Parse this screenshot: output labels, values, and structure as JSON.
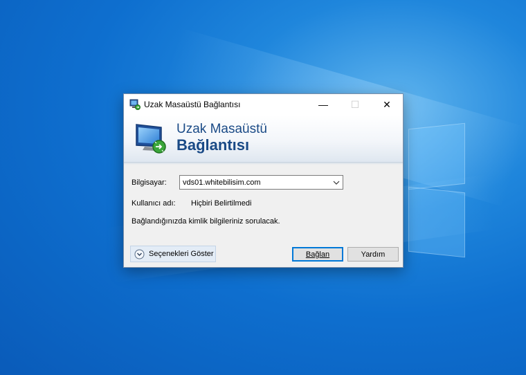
{
  "window": {
    "title": "Uzak Masaüstü Bağlantısı",
    "controls": {
      "minimize": "—",
      "maximize": "☐",
      "close": "✕"
    }
  },
  "banner": {
    "line1": "Uzak Masaüstü",
    "line2": "Bağlantısı"
  },
  "form": {
    "computer_label": "Bilgisayar:",
    "computer_value": "vds01.whitebilisim.com",
    "username_label": "Kullanıcı adı:",
    "username_value": "Hiçbiri Belirtilmedi",
    "info_text": "Bağlandığınızda kimlik bilgileriniz sorulacak."
  },
  "buttons": {
    "options": "Seçenekleri Göster",
    "connect": "Bağlan",
    "help": "Yardım"
  },
  "icons": {
    "app": "remote-desktop-icon",
    "banner": "monitor-connection-icon",
    "combo": "chevron-down-icon",
    "options": "expand-circle-icon"
  },
  "colors": {
    "banner_text": "#1a4a86",
    "focus_border": "#0078d7"
  }
}
